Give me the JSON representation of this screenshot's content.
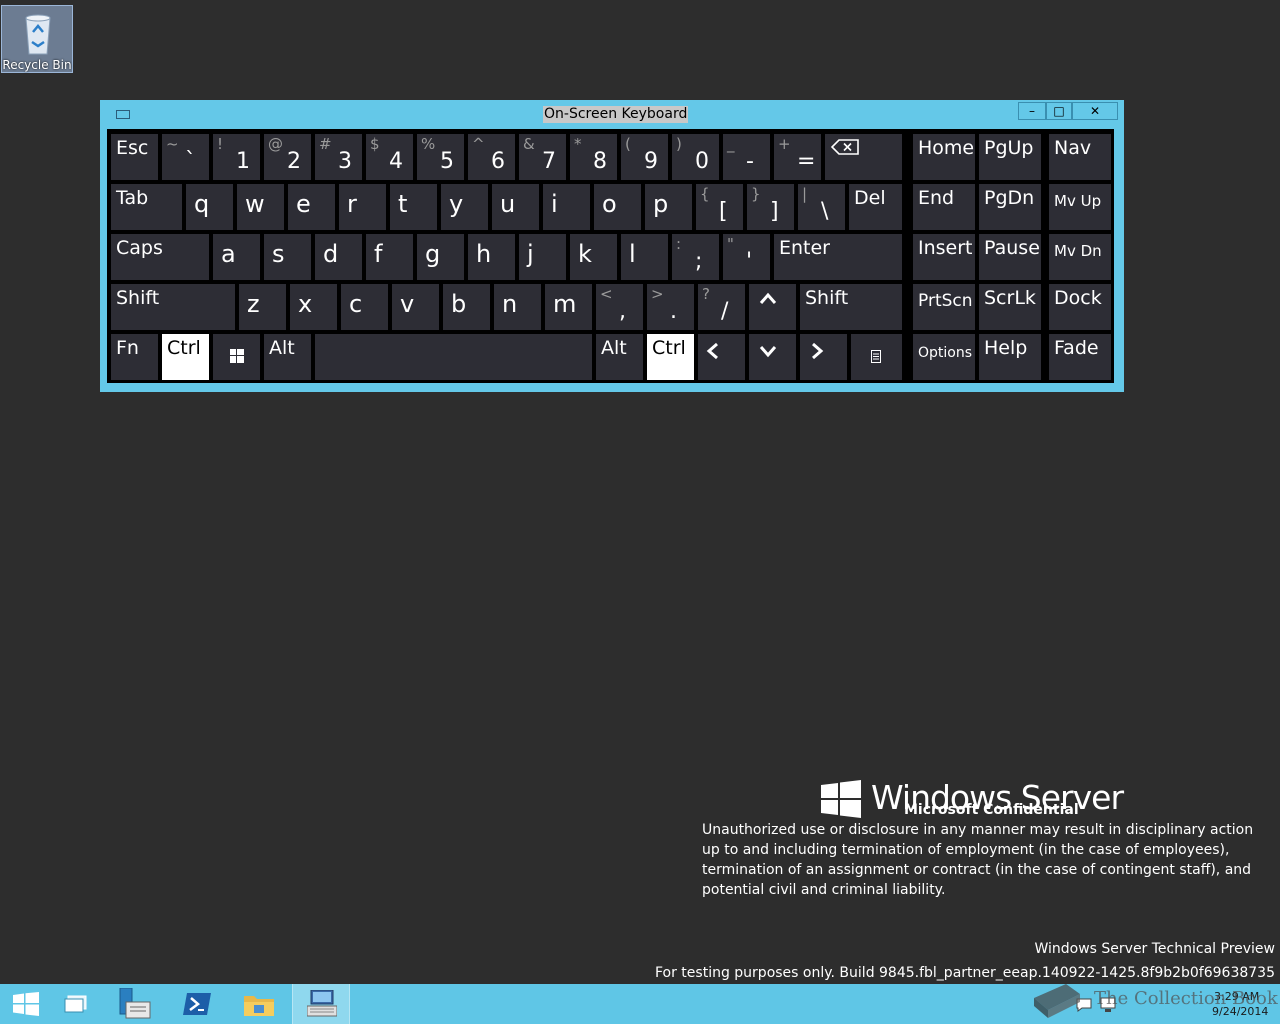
{
  "desktop": {
    "recycle_bin_label": "Recycle Bin"
  },
  "window": {
    "title": "On-Screen Keyboard",
    "minimize": "–",
    "maximize": "□",
    "close": "✕"
  },
  "keys": {
    "esc": "Esc",
    "num": [
      {
        "s": "~",
        "m": "`"
      },
      {
        "s": "!",
        "m": "1"
      },
      {
        "s": "@",
        "m": "2"
      },
      {
        "s": "#",
        "m": "3"
      },
      {
        "s": "$",
        "m": "4"
      },
      {
        "s": "%",
        "m": "5"
      },
      {
        "s": "^",
        "m": "6"
      },
      {
        "s": "&",
        "m": "7"
      },
      {
        "s": "*",
        "m": "8"
      },
      {
        "s": "(",
        "m": "9"
      },
      {
        "s": ")",
        "m": "0"
      },
      {
        "s": "_",
        "m": "-"
      },
      {
        "s": "+",
        "m": "="
      }
    ],
    "tab": "Tab",
    "row_q": [
      "q",
      "w",
      "e",
      "r",
      "t",
      "y",
      "u",
      "i",
      "o",
      "p"
    ],
    "brackets": [
      {
        "s": "{",
        "m": "["
      },
      {
        "s": "}",
        "m": "]"
      },
      {
        "s": "|",
        "m": "\\"
      }
    ],
    "del": "Del",
    "caps": "Caps",
    "row_a": [
      "a",
      "s",
      "d",
      "f",
      "g",
      "h",
      "j",
      "k",
      "l"
    ],
    "semis": [
      {
        "s": ":",
        "m": ";"
      },
      {
        "s": "\"",
        "m": "'"
      }
    ],
    "enter": "Enter",
    "shift": "Shift",
    "row_z": [
      "z",
      "x",
      "c",
      "v",
      "b",
      "n",
      "m"
    ],
    "puncts": [
      {
        "s": "<",
        "m": ","
      },
      {
        "s": ">",
        "m": "."
      },
      {
        "s": "?",
        "m": "/"
      }
    ],
    "fn": "Fn",
    "ctrl": "Ctrl",
    "alt": "Alt",
    "nav": {
      "home": "Home",
      "pgup": "PgUp",
      "nav": "Nav",
      "end": "End",
      "pgdn": "PgDn",
      "mvup": "Mv Up",
      "insert": "Insert",
      "pause": "Pause",
      "mvdn": "Mv Dn",
      "prtscn": "PrtScn",
      "scrlk": "ScrLk",
      "dock": "Dock",
      "options": "Options",
      "help": "Help",
      "fade": "Fade"
    }
  },
  "watermark": {
    "product": "Windows Server",
    "confidential": "Microsoft Confidential",
    "legal": "Unauthorized use or disclosure in any manner may result in disciplinary action up to and including termination of employment (in the case of employees), termination of an assignment or contract (in the case of contingent staff), and potential civil and criminal liability.",
    "preview": "Windows Server Technical Preview",
    "build": "For testing purposes only. Build 9845.fbl_partner_eeap.140922-1425.8f9b2b0f69638735",
    "collection": "The Collection Book"
  },
  "taskbar": {
    "time": "3:29 AM",
    "date": "9/24/2014"
  },
  "colors": {
    "accent": "#64c8e8",
    "key": "#2d2d35",
    "desktop": "#2d2d2d"
  }
}
